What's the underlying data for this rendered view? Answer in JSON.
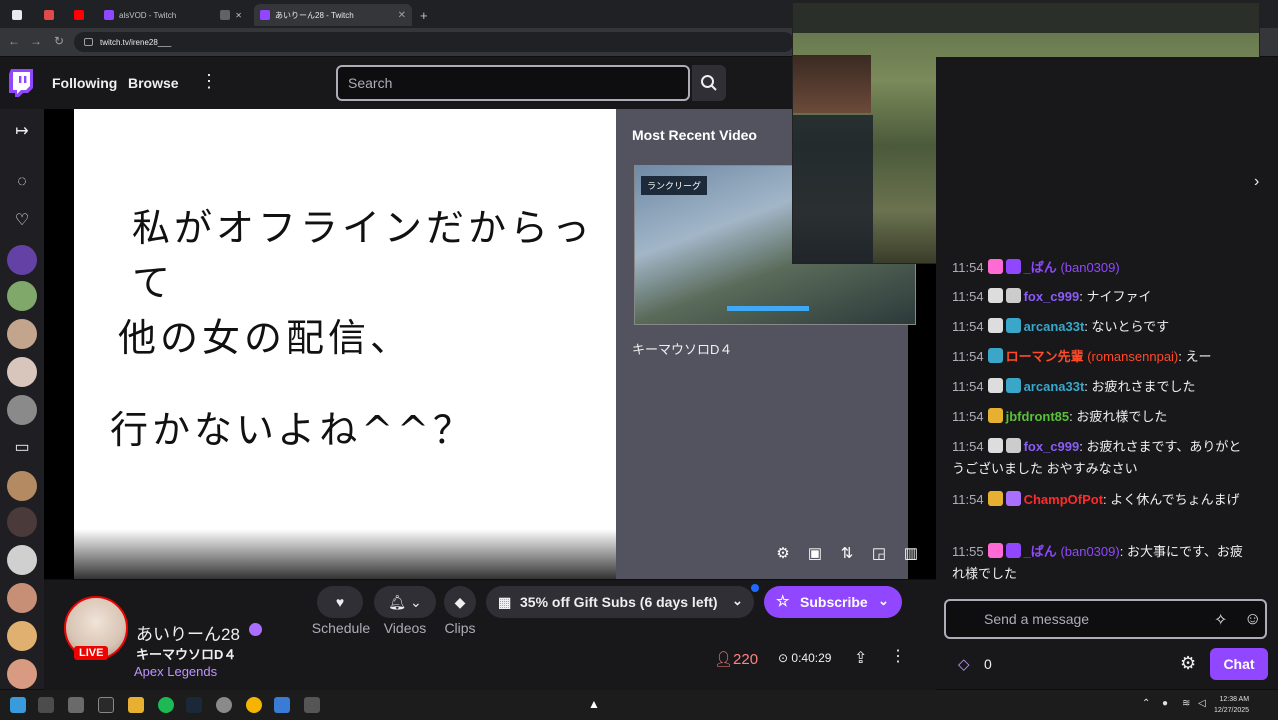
{
  "browser": {
    "tabs": [
      {
        "label": ""
      },
      {
        "label": ""
      },
      {
        "label": ""
      },
      {
        "label": "alsVOD - Twitch"
      },
      {
        "label": ""
      },
      {
        "label": "あいりーん28 - Twitch"
      }
    ],
    "new_tab": "+",
    "url": "twitch.tv/irene28___"
  },
  "topnav": {
    "following": "Following",
    "browse": "Browse",
    "more": "⋮",
    "search_placeholder": "Search"
  },
  "player": {
    "offline_lines": [
      "私がオフラインだからって",
      "他の女の配信、",
      "行かないよね^^？"
    ],
    "most_recent_title": "Most Recent Video",
    "recent_tag": "ランクリーグ",
    "recent_caption": "キーマウソロD４"
  },
  "channel": {
    "name": "あいりーん28",
    "live": "LIVE",
    "title": "キーマウソロD４",
    "game": "Apex Legends",
    "schedule": "Schedule",
    "videos": "Videos",
    "clips": "Clips",
    "gift": "35% off Gift Subs (6 days left)",
    "subscribe": "Subscribe",
    "viewers": "220",
    "uptime": "0:40:29"
  },
  "chat": {
    "messages": [
      {
        "time": "11:54",
        "user": "_ぱん",
        "login": "(ban0309)",
        "text": "",
        "color": "#9147ff"
      },
      {
        "time": "11:54",
        "user": "fox_c999",
        "login": "",
        "text": "ナイファイ",
        "color": "#8a5cf6"
      },
      {
        "time": "11:54",
        "user": "arcana33t",
        "login": "",
        "text": "ないとらです",
        "color": "#3aa7c9"
      },
      {
        "time": "11:54",
        "user": "ローマン先輩",
        "login": "(romansennpai)",
        "text": "えー",
        "color": "#ff4a2a"
      },
      {
        "time": "11:54",
        "user": "arcana33t",
        "login": "",
        "text": "お疲れさまでした",
        "color": "#3aa7c9"
      },
      {
        "time": "11:54",
        "user": "jbfdront85",
        "login": "",
        "text": "お疲れ様でした",
        "color": "#5bbf3a"
      },
      {
        "time": "11:54",
        "user": "fox_c999",
        "login": "",
        "text": "お疲れさまです、ありがとうございました おやすみなさい",
        "color": "#8a5cf6"
      },
      {
        "time": "11:54",
        "user": "ChampOfPot",
        "login": "",
        "text": "よく休んでちょんまげ",
        "color": "#ff2a2a"
      },
      {
        "time": "11:55",
        "user": "_ぱん",
        "login": "(ban0309)",
        "text": "お大事にです、お疲れ様でした",
        "color": "#9147ff"
      }
    ],
    "input_placeholder": "Send a message",
    "points": "0",
    "chat_button": "Chat"
  },
  "taskbar": {
    "time": "12:38 AM",
    "date": "12/27/2025"
  },
  "colors": {
    "twitch_purple": "#9147ff",
    "live_red": "#eb0400",
    "viewer_red": "#ff8280"
  }
}
